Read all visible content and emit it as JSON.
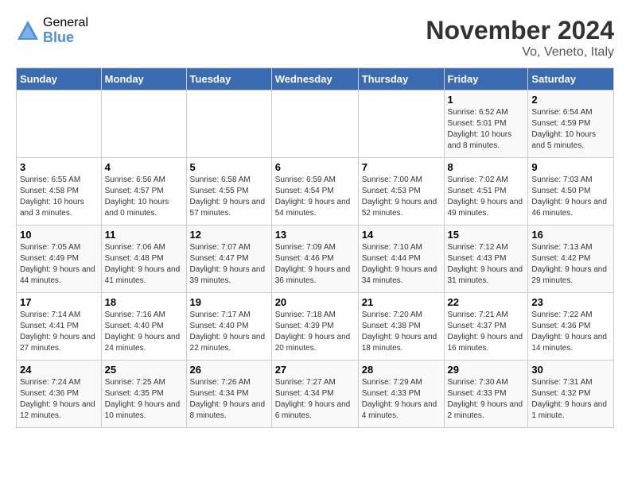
{
  "logo": {
    "general": "General",
    "blue": "Blue"
  },
  "title": "November 2024",
  "subtitle": "Vo, Veneto, Italy",
  "weekdays": [
    "Sunday",
    "Monday",
    "Tuesday",
    "Wednesday",
    "Thursday",
    "Friday",
    "Saturday"
  ],
  "weeks": [
    [
      {
        "day": "",
        "info": ""
      },
      {
        "day": "",
        "info": ""
      },
      {
        "day": "",
        "info": ""
      },
      {
        "day": "",
        "info": ""
      },
      {
        "day": "",
        "info": ""
      },
      {
        "day": "1",
        "info": "Sunrise: 6:52 AM\nSunset: 5:01 PM\nDaylight: 10 hours and 8 minutes."
      },
      {
        "day": "2",
        "info": "Sunrise: 6:54 AM\nSunset: 4:59 PM\nDaylight: 10 hours and 5 minutes."
      }
    ],
    [
      {
        "day": "3",
        "info": "Sunrise: 6:55 AM\nSunset: 4:58 PM\nDaylight: 10 hours and 3 minutes."
      },
      {
        "day": "4",
        "info": "Sunrise: 6:56 AM\nSunset: 4:57 PM\nDaylight: 10 hours and 0 minutes."
      },
      {
        "day": "5",
        "info": "Sunrise: 6:58 AM\nSunset: 4:55 PM\nDaylight: 9 hours and 57 minutes."
      },
      {
        "day": "6",
        "info": "Sunrise: 6:59 AM\nSunset: 4:54 PM\nDaylight: 9 hours and 54 minutes."
      },
      {
        "day": "7",
        "info": "Sunrise: 7:00 AM\nSunset: 4:53 PM\nDaylight: 9 hours and 52 minutes."
      },
      {
        "day": "8",
        "info": "Sunrise: 7:02 AM\nSunset: 4:51 PM\nDaylight: 9 hours and 49 minutes."
      },
      {
        "day": "9",
        "info": "Sunrise: 7:03 AM\nSunset: 4:50 PM\nDaylight: 9 hours and 46 minutes."
      }
    ],
    [
      {
        "day": "10",
        "info": "Sunrise: 7:05 AM\nSunset: 4:49 PM\nDaylight: 9 hours and 44 minutes."
      },
      {
        "day": "11",
        "info": "Sunrise: 7:06 AM\nSunset: 4:48 PM\nDaylight: 9 hours and 41 minutes."
      },
      {
        "day": "12",
        "info": "Sunrise: 7:07 AM\nSunset: 4:47 PM\nDaylight: 9 hours and 39 minutes."
      },
      {
        "day": "13",
        "info": "Sunrise: 7:09 AM\nSunset: 4:46 PM\nDaylight: 9 hours and 36 minutes."
      },
      {
        "day": "14",
        "info": "Sunrise: 7:10 AM\nSunset: 4:44 PM\nDaylight: 9 hours and 34 minutes."
      },
      {
        "day": "15",
        "info": "Sunrise: 7:12 AM\nSunset: 4:43 PM\nDaylight: 9 hours and 31 minutes."
      },
      {
        "day": "16",
        "info": "Sunrise: 7:13 AM\nSunset: 4:42 PM\nDaylight: 9 hours and 29 minutes."
      }
    ],
    [
      {
        "day": "17",
        "info": "Sunrise: 7:14 AM\nSunset: 4:41 PM\nDaylight: 9 hours and 27 minutes."
      },
      {
        "day": "18",
        "info": "Sunrise: 7:16 AM\nSunset: 4:40 PM\nDaylight: 9 hours and 24 minutes."
      },
      {
        "day": "19",
        "info": "Sunrise: 7:17 AM\nSunset: 4:40 PM\nDaylight: 9 hours and 22 minutes."
      },
      {
        "day": "20",
        "info": "Sunrise: 7:18 AM\nSunset: 4:39 PM\nDaylight: 9 hours and 20 minutes."
      },
      {
        "day": "21",
        "info": "Sunrise: 7:20 AM\nSunset: 4:38 PM\nDaylight: 9 hours and 18 minutes."
      },
      {
        "day": "22",
        "info": "Sunrise: 7:21 AM\nSunset: 4:37 PM\nDaylight: 9 hours and 16 minutes."
      },
      {
        "day": "23",
        "info": "Sunrise: 7:22 AM\nSunset: 4:36 PM\nDaylight: 9 hours and 14 minutes."
      }
    ],
    [
      {
        "day": "24",
        "info": "Sunrise: 7:24 AM\nSunset: 4:36 PM\nDaylight: 9 hours and 12 minutes."
      },
      {
        "day": "25",
        "info": "Sunrise: 7:25 AM\nSunset: 4:35 PM\nDaylight: 9 hours and 10 minutes."
      },
      {
        "day": "26",
        "info": "Sunrise: 7:26 AM\nSunset: 4:34 PM\nDaylight: 9 hours and 8 minutes."
      },
      {
        "day": "27",
        "info": "Sunrise: 7:27 AM\nSunset: 4:34 PM\nDaylight: 9 hours and 6 minutes."
      },
      {
        "day": "28",
        "info": "Sunrise: 7:29 AM\nSunset: 4:33 PM\nDaylight: 9 hours and 4 minutes."
      },
      {
        "day": "29",
        "info": "Sunrise: 7:30 AM\nSunset: 4:33 PM\nDaylight: 9 hours and 2 minutes."
      },
      {
        "day": "30",
        "info": "Sunrise: 7:31 AM\nSunset: 4:32 PM\nDaylight: 9 hours and 1 minute."
      }
    ]
  ]
}
